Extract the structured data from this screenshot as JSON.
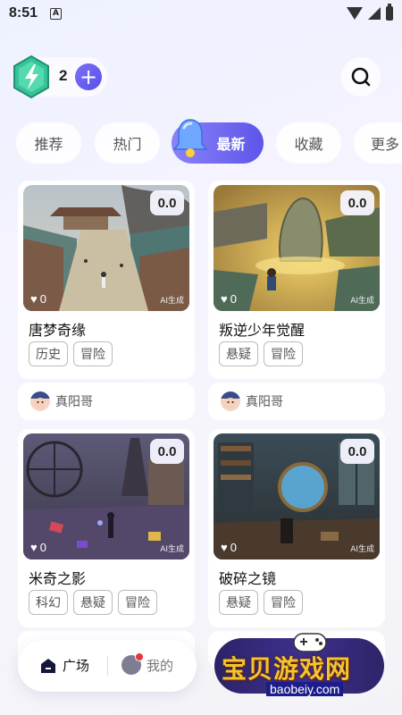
{
  "status": {
    "time": "8:51",
    "indicator": "A"
  },
  "header": {
    "energy_count": "2",
    "plus": "+"
  },
  "tabs": [
    "推荐",
    "热门",
    "最新",
    "收藏",
    "更多"
  ],
  "active_tab": "最新",
  "cards": [
    {
      "score": "0.0",
      "likes": "0",
      "ai_tag": "AI生成",
      "title": "唐梦奇缘",
      "tags": [
        "历史",
        "冒险"
      ],
      "author": "真阳哥"
    },
    {
      "score": "0.0",
      "likes": "0",
      "ai_tag": "AI生成",
      "title": "叛逆少年觉醒",
      "tags": [
        "悬疑",
        "冒险"
      ],
      "author": "真阳哥"
    },
    {
      "score": "0.0",
      "likes": "0",
      "ai_tag": "AI生成",
      "title": "米奇之影",
      "tags": [
        "科幻",
        "悬疑",
        "冒险"
      ]
    },
    {
      "score": "0.0",
      "likes": "0",
      "ai_tag": "AI生成",
      "title": "破碎之镜",
      "tags": [
        "悬疑",
        "冒险"
      ]
    }
  ],
  "bottom_nav": {
    "home": "广场",
    "mine": "我的"
  },
  "watermark": {
    "text": "宝贝游戏网",
    "url": "baobeiy.com"
  },
  "colors": {
    "accent": "#6a61f0",
    "badge_red": "#e8353d",
    "watermark_gold": "#f4c430"
  }
}
